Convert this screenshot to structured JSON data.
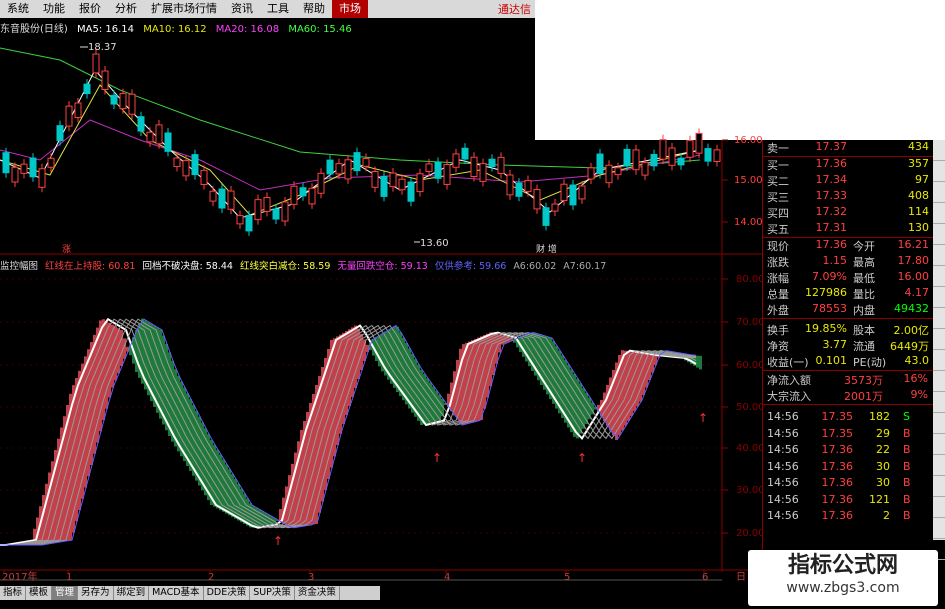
{
  "menu": {
    "items": [
      "系统",
      "功能",
      "报价",
      "分析",
      "扩展市场行情",
      "资讯",
      "工具",
      "帮助",
      "市场"
    ],
    "active_index": 8,
    "right_text": "通达信"
  },
  "chart_header": {
    "stock": "东音股份(日线)",
    "ma5": "MA5: 16.14",
    "ma10": "MA10: 16.12",
    "ma20": "MA20: 16.08",
    "ma60": "MA60: 15.46",
    "high_label": "18.37",
    "low_label": "13.60",
    "badge1": "涨",
    "badge2": "财 增"
  },
  "price_axis": [
    "16.00",
    "15.00",
    "14.00"
  ],
  "indicator_header": {
    "name": "监控幅图",
    "items": [
      "红线在上持股: 60.81",
      "回档不破决盘: 58.44",
      "红线突白减仓: 58.59",
      "无量回跌空仓: 59.13",
      "仅供参考: 59.66",
      "A6:60.02",
      "A7:60.17"
    ]
  },
  "ind_axis": [
    "80.00",
    "70.00",
    "60.00",
    "50.00",
    "40.00",
    "30.00",
    "20.00"
  ],
  "date_axis": [
    "2017年",
    "1",
    "2",
    "3",
    "4",
    "5",
    "6"
  ],
  "date_axis_corner": "日",
  "quote": {
    "sells": [
      {
        "label": "卖一",
        "price": "17.37",
        "vol": "434"
      }
    ],
    "buys": [
      {
        "label": "买一",
        "price": "17.36",
        "vol": "357"
      },
      {
        "label": "买二",
        "price": "17.34",
        "vol": "97"
      },
      {
        "label": "买三",
        "price": "17.33",
        "vol": "408"
      },
      {
        "label": "买四",
        "price": "17.32",
        "vol": "114"
      },
      {
        "label": "买五",
        "price": "17.31",
        "vol": "130"
      }
    ],
    "stats1": [
      {
        "l1": "现价",
        "v1": "17.36",
        "l2": "今开",
        "v2": "16.21"
      },
      {
        "l1": "涨跌",
        "v1": "1.15",
        "l2": "最高",
        "v2": "17.80"
      },
      {
        "l1": "涨幅",
        "v1": "7.09%",
        "l2": "最低",
        "v2": "16.00"
      },
      {
        "l1": "总量",
        "v1": "127986",
        "l2": "量比",
        "v2": "4.17"
      },
      {
        "l1": "外盘",
        "v1": "78553",
        "l2": "内盘",
        "v2": "49432"
      }
    ],
    "stats2": [
      {
        "l1": "换手",
        "v1": "19.85%",
        "l2": "股本",
        "v2": "2.00亿"
      },
      {
        "l1": "净资",
        "v1": "3.77",
        "l2": "流通",
        "v2": "6449万"
      },
      {
        "l1": "收益(一)",
        "v1": "0.101",
        "l2": "PE(动)",
        "v2": "43.0"
      }
    ],
    "flows": [
      {
        "l": "净流入额",
        "v": "3573万",
        "p": "16%"
      },
      {
        "l": "大宗流入",
        "v": "2001万",
        "p": "9%"
      }
    ],
    "ticks": [
      {
        "t": "14:56",
        "p": "17.35",
        "v": "182",
        "s": "S"
      },
      {
        "t": "14:56",
        "p": "17.35",
        "v": "29",
        "s": "B"
      },
      {
        "t": "14:56",
        "p": "17.36",
        "v": "22",
        "s": "B"
      },
      {
        "t": "14:56",
        "p": "17.36",
        "v": "30",
        "s": "B"
      },
      {
        "t": "14:56",
        "p": "17.36",
        "v": "30",
        "s": "B"
      },
      {
        "t": "14:56",
        "p": "17.36",
        "v": "121",
        "s": "B"
      },
      {
        "t": "14:56",
        "p": "17.36",
        "v": "2",
        "s": "B"
      }
    ]
  },
  "tabs": [
    "指标",
    "模板",
    "管理",
    "另存为",
    "绑定到",
    "MACD基本",
    "DDE决策",
    "SUP决策",
    "资金决策"
  ],
  "active_tab": 2,
  "watermark": {
    "title": "指标公式网",
    "url": "www.zbgs3.com"
  },
  "colors": {
    "up": "#ff3030",
    "down": "#00c8c8",
    "bg": "#000000",
    "grid": "#8a0000",
    "red_fill": "#c2404a",
    "green_fill": "#1e7a3a"
  }
}
